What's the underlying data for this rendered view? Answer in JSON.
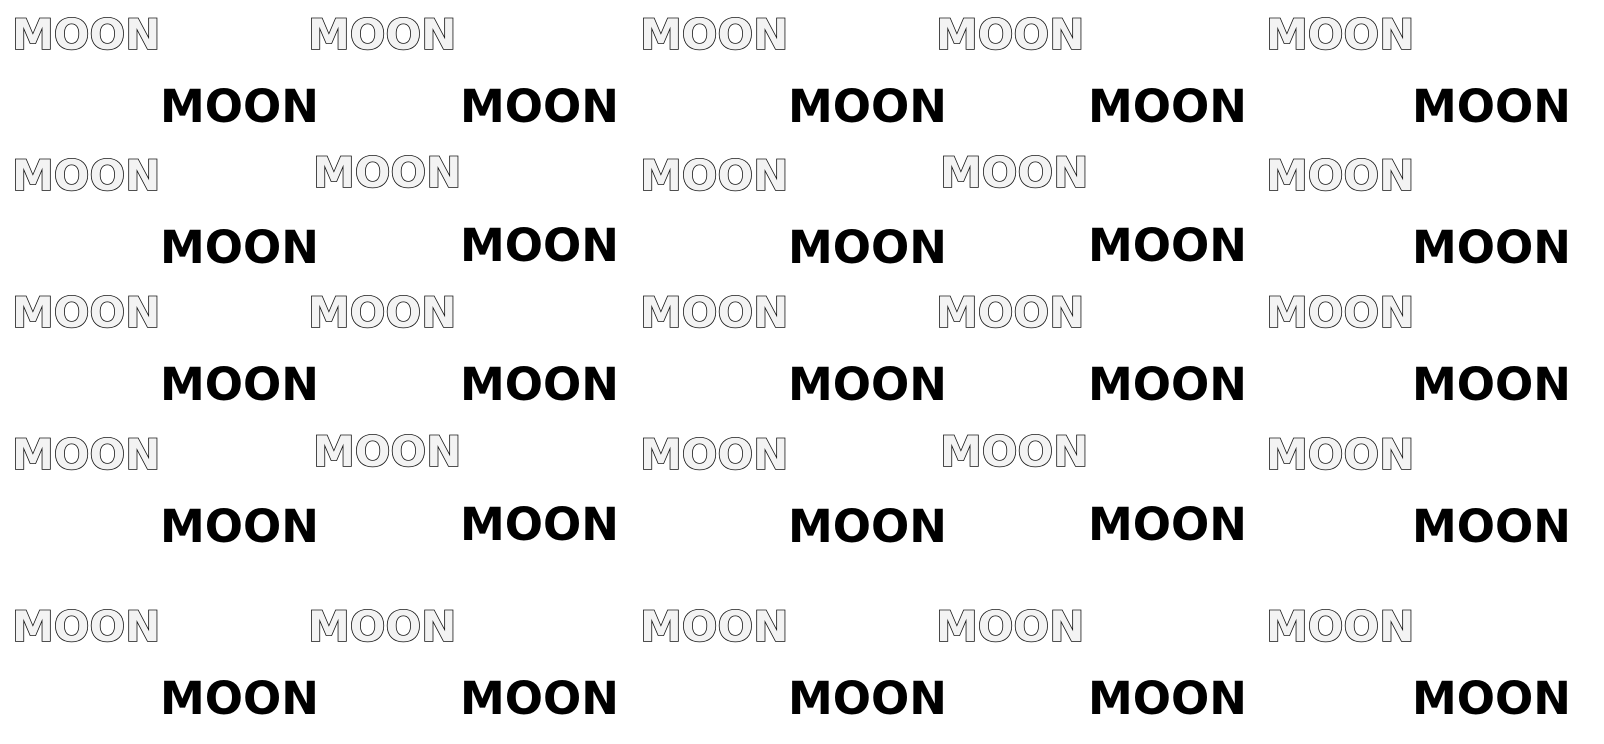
{
  "pattern": {
    "text": "MOON",
    "rows": [
      {
        "outline": [
          "MOON",
          "MOON",
          "MOON",
          "MOON",
          "MOON"
        ],
        "solid": [
          "MOON",
          "MOON",
          "MOON",
          "MOON",
          "MOON"
        ]
      },
      {
        "outline": [
          "MOON",
          "MOON",
          "MOON",
          "MOON",
          "MOON"
        ],
        "solid": [
          "MOON",
          "MOON",
          "MOON",
          "MOON",
          "MOON"
        ]
      },
      {
        "outline": [
          "MOON",
          "MOON",
          "MOON",
          "MOON",
          "MOON"
        ],
        "solid": [
          "MOON",
          "MOON",
          "MOON",
          "MOON",
          "MOON"
        ]
      },
      {
        "outline": [
          "MOON",
          "MOON",
          "MOON",
          "MOON",
          "MOON"
        ],
        "solid": [
          "MOON",
          "MOON",
          "MOON",
          "MOON",
          "MOON"
        ]
      },
      {
        "outline": [
          "MOON",
          "MOON",
          "MOON",
          "MOON",
          "MOON"
        ],
        "solid": [
          "MOON",
          "MOON",
          "MOON",
          "MOON",
          "MOON"
        ]
      }
    ]
  },
  "colors": {
    "background": "#ffffff",
    "text": "#000000",
    "outline_fill": "#f3f3f3",
    "outline_stroke": "#111111"
  }
}
